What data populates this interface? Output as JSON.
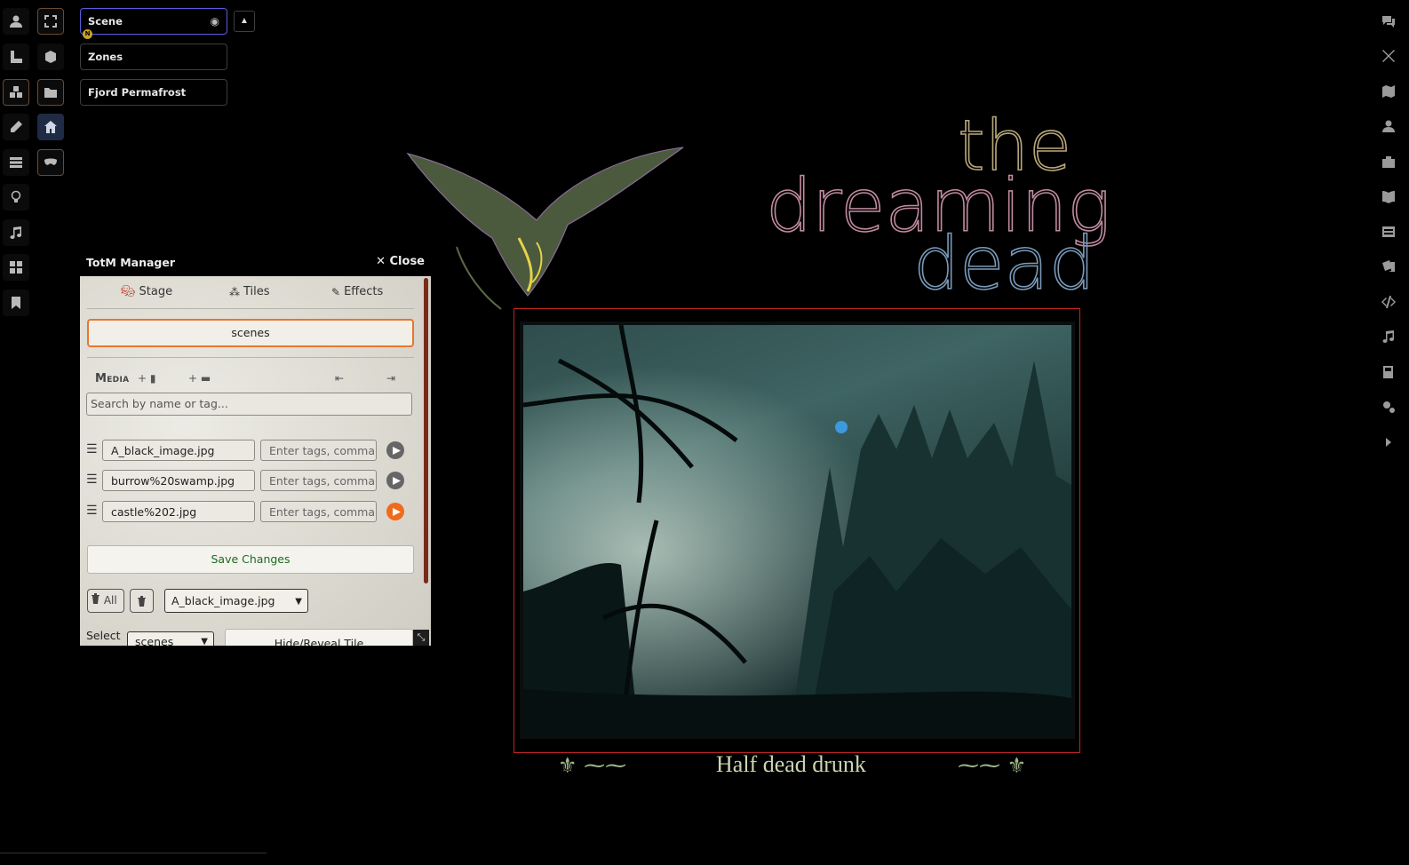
{
  "left_toolbar": {
    "tools": [
      {
        "id": "token",
        "icon": "user-icon"
      },
      {
        "id": "measure",
        "icon": "ruler-icon"
      },
      {
        "id": "tiles",
        "icon": "cubes-icon"
      },
      {
        "id": "drawings",
        "icon": "pencil-icon"
      },
      {
        "id": "walls",
        "icon": "wall-icon"
      },
      {
        "id": "lighting",
        "icon": "lightbulb-icon"
      },
      {
        "id": "sounds",
        "icon": "music-icon"
      },
      {
        "id": "regions",
        "icon": "grid-icon"
      },
      {
        "id": "notes",
        "icon": "bookmark-icon"
      }
    ],
    "subtools": [
      {
        "id": "fullscreen",
        "icon": "expand-icon"
      },
      {
        "id": "cube",
        "icon": "cube-icon"
      },
      {
        "id": "folder",
        "icon": "folder-icon"
      },
      {
        "id": "home",
        "icon": "home-icon"
      },
      {
        "id": "mask",
        "icon": "mask-icon"
      }
    ]
  },
  "scene_nav": {
    "items": [
      "Scene",
      "Zones",
      "Fjord Permafrost"
    ],
    "badge": "N"
  },
  "panel": {
    "title": "TotM Manager",
    "close_label": "Close",
    "tabs": {
      "stage": "Stage",
      "tiles": "Tiles",
      "effects": "Effects"
    },
    "scenes_button": "scenes",
    "media_label": "Media",
    "search_placeholder": "Search by name or tag...",
    "tags_placeholder": "Enter tags, comma",
    "files": [
      {
        "name": "A_black_image.jpg",
        "active": false
      },
      {
        "name": "burrow%20swamp.jpg",
        "active": false
      },
      {
        "name": "castle%202.jpg",
        "active": true
      }
    ],
    "save_label": "Save Changes",
    "delete_all_label": "All",
    "selected_file": "A_black_image.jpg",
    "select_label": "Select",
    "select_value": "scenes",
    "hide_reveal_label": "Hide/Reveal Tile"
  },
  "right_toolbar": {
    "icons": [
      "chat-icon",
      "combat-icon",
      "map-icon",
      "actor-icon",
      "items-icon",
      "journal-icon",
      "tables-icon",
      "cards-icon",
      "macros-icon",
      "playlist-icon",
      "compendium-icon",
      "settings-icon",
      "collapse-icon"
    ]
  },
  "canvas": {
    "logo_lines": [
      "the",
      "dreaming",
      "dead"
    ],
    "caption": "Half dead drunk"
  },
  "colors": {
    "accent": "#e8772e",
    "frame": "#c32222",
    "save_text": "#1e6b1e"
  }
}
